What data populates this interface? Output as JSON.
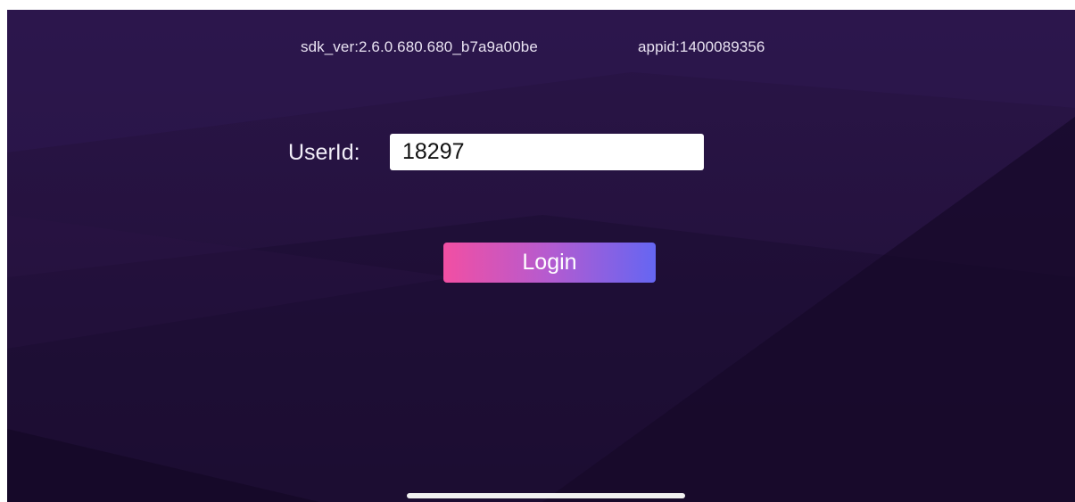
{
  "header": {
    "sdk_version": "sdk_ver:2.6.0.680.680_b7a9a00be",
    "appid": "appid:1400089356"
  },
  "login_form": {
    "user_id_label": "UserId:",
    "user_id_value": "18297",
    "login_label": "Login"
  },
  "colors": {
    "background": "#25123f",
    "button_gradient_start": "#f24fa3",
    "button_gradient_end": "#6566f2"
  }
}
